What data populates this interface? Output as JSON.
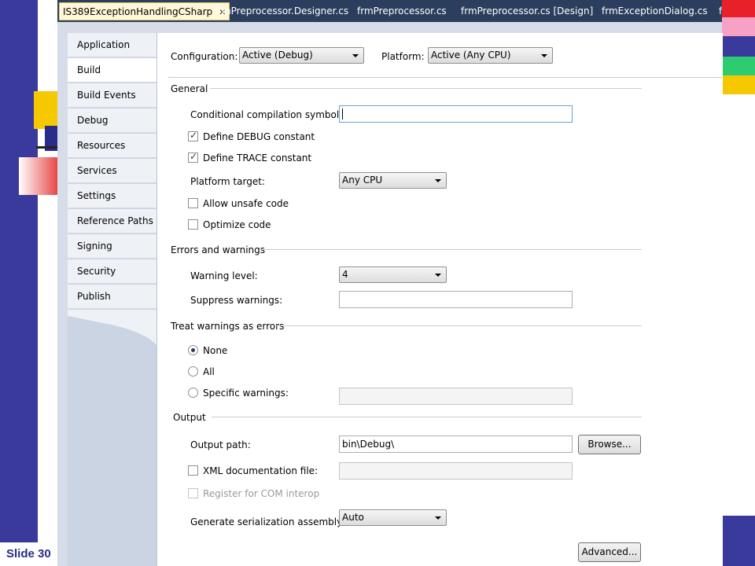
{
  "slide": {
    "number_label": "Slide 30"
  },
  "decor_colors": {
    "left_bar": "#3a3a9c",
    "red": "#e84040",
    "pink": "#f7a1c6",
    "navy": "#3a3a9c",
    "green": "#2ecc71",
    "yellow": "#f5c800"
  },
  "tabs": [
    {
      "label": "IS389ExceptionHandlingCSharp",
      "close": "✕",
      "active": true
    },
    {
      "label": "frmPreprocessor.Designer.cs",
      "active": false
    },
    {
      "label": "frmPreprocessor.cs",
      "active": false
    },
    {
      "label": "frmPreprocessor.cs [Design]",
      "active": false
    },
    {
      "label": "frmExceptionDialog.cs",
      "active": false
    },
    {
      "label": "f",
      "active": false
    }
  ],
  "nav": {
    "items": [
      "Application",
      "Build",
      "Build Events",
      "Debug",
      "Resources",
      "Services",
      "Settings",
      "Reference Paths",
      "Signing",
      "Security",
      "Publish"
    ],
    "selected": "Build"
  },
  "toolbar": {
    "configuration_label": "Configuration:",
    "configuration_value": "Active (Debug)",
    "platform_label": "Platform:",
    "platform_value": "Active (Any CPU)"
  },
  "general": {
    "heading": "General",
    "symbols_label": "Conditional compilation symbols:",
    "symbols_value": "",
    "define_debug_label": "Define DEBUG constant",
    "define_debug_checked": true,
    "define_trace_label": "Define TRACE constant",
    "define_trace_checked": true,
    "platform_target_label": "Platform target:",
    "platform_target_value": "Any CPU",
    "allow_unsafe_label": "Allow unsafe code",
    "allow_unsafe_checked": false,
    "optimize_label": "Optimize code",
    "optimize_checked": false
  },
  "errors": {
    "heading": "Errors and warnings",
    "warning_level_label": "Warning level:",
    "warning_level_value": "4",
    "suppress_label": "Suppress warnings:",
    "suppress_value": ""
  },
  "treat": {
    "heading": "Treat warnings as errors",
    "none_label": "None",
    "all_label": "All",
    "specific_label": "Specific warnings:",
    "selected": "None",
    "specific_value": ""
  },
  "output": {
    "heading": "Output",
    "path_label": "Output path:",
    "path_value": "bin\\Debug\\",
    "browse_label": "Browse...",
    "xml_doc_label": "XML documentation file:",
    "xml_doc_checked": false,
    "xml_doc_value": "",
    "com_interop_label": "Register for COM interop",
    "com_interop_checked": false,
    "serialization_label": "Generate serialization assembly:",
    "serialization_value": "Auto",
    "advanced_label": "Advanced..."
  }
}
